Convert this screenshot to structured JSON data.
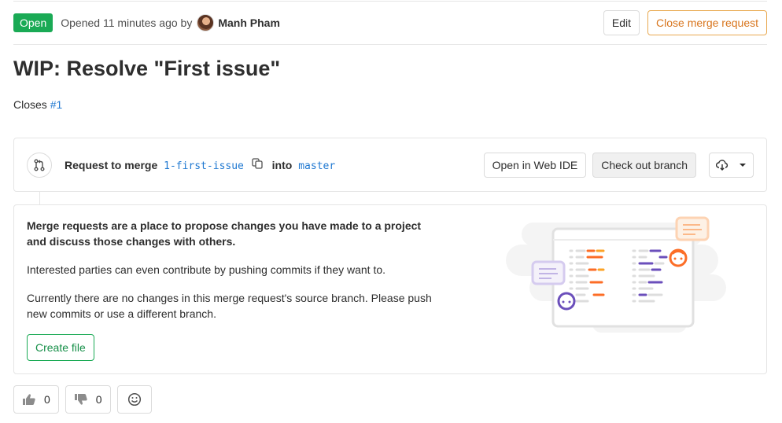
{
  "header": {
    "status_badge": "Open",
    "opened_text": "Opened 11 minutes ago by",
    "author": "Manh Pham",
    "edit_label": "Edit",
    "close_label": "Close merge request"
  },
  "title": "WIP: Resolve \"First issue\"",
  "description": {
    "closes_label": "Closes",
    "issue_ref": "#1"
  },
  "widget": {
    "request_label": "Request to merge",
    "source_branch": "1-first-issue",
    "into_label": "into",
    "target_branch": "master",
    "web_ide_label": "Open in Web IDE",
    "checkout_label": "Check out branch"
  },
  "empty_state": {
    "lead": "Merge requests are a place to propose changes you have made to a project and discuss those changes with others.",
    "para1": "Interested parties can even contribute by pushing commits if they want to.",
    "para2": "Currently there are no changes in this merge request's source branch. Please push new commits or use a different branch.",
    "create_file_label": "Create file"
  },
  "awards": {
    "thumbsup_count": "0",
    "thumbsdown_count": "0"
  },
  "colors": {
    "accent_green": "#1aaa55",
    "warning_orange": "#e9a951",
    "link_blue": "#1f78d1",
    "illustration_purple": "#6b4fbb",
    "illustration_orange": "#fc6d26"
  }
}
